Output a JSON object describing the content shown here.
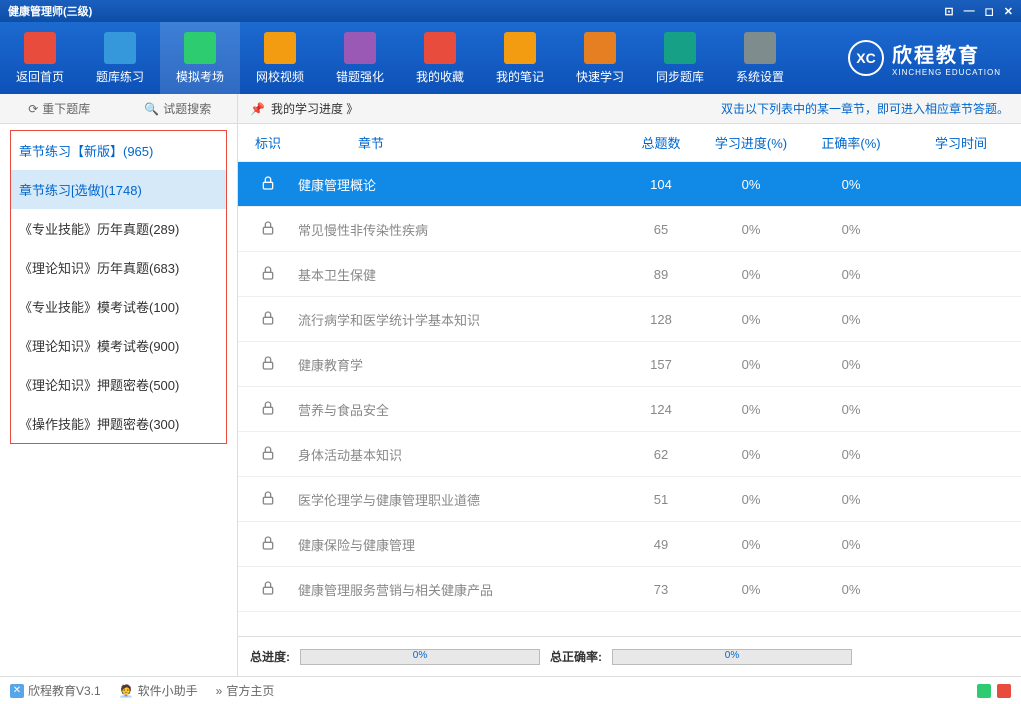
{
  "window": {
    "title": "健康管理师(三级)"
  },
  "toolbar": {
    "items": [
      {
        "label": "返回首页"
      },
      {
        "label": "题库练习"
      },
      {
        "label": "模拟考场"
      },
      {
        "label": "网校视频"
      },
      {
        "label": "错题强化"
      },
      {
        "label": "我的收藏"
      },
      {
        "label": "我的笔记"
      },
      {
        "label": "快速学习"
      },
      {
        "label": "同步题库"
      },
      {
        "label": "系统设置"
      }
    ],
    "active_index": 2
  },
  "brand": {
    "code": "XC",
    "cn": "欣程教育",
    "en": "XINCHENG EDUCATION"
  },
  "subbar": {
    "reload": "重下题库",
    "search": "试题搜索",
    "progress": "我的学习进度 》",
    "hint": "双击以下列表中的某一章节，即可进入相应章节答题。"
  },
  "sidebar": {
    "items": [
      {
        "label": "章节练习【新版】(965)",
        "blue": true
      },
      {
        "label": "章节练习[选做](1748)",
        "selected": true
      },
      {
        "label": "《专业技能》历年真题(289)"
      },
      {
        "label": "《理论知识》历年真题(683)"
      },
      {
        "label": "《专业技能》模考试卷(100)"
      },
      {
        "label": "《理论知识》模考试卷(900)"
      },
      {
        "label": "《理论知识》押题密卷(500)"
      },
      {
        "label": "《操作技能》押题密卷(300)"
      }
    ]
  },
  "table": {
    "headers": {
      "flag": "标识",
      "chapter": "章节",
      "total": "总题数",
      "progress": "学习进度(%)",
      "correct": "正确率(%)",
      "time": "学习时间"
    },
    "rows": [
      {
        "chapter": "健康管理概论",
        "total": 104,
        "progress": "0%",
        "correct": "0%",
        "active": true
      },
      {
        "chapter": "常见慢性非传染性疾病",
        "total": 65,
        "progress": "0%",
        "correct": "0%"
      },
      {
        "chapter": "基本卫生保健",
        "total": 89,
        "progress": "0%",
        "correct": "0%"
      },
      {
        "chapter": "流行病学和医学统计学基本知识",
        "total": 128,
        "progress": "0%",
        "correct": "0%"
      },
      {
        "chapter": "健康教育学",
        "total": 157,
        "progress": "0%",
        "correct": "0%"
      },
      {
        "chapter": "营养与食品安全",
        "total": 124,
        "progress": "0%",
        "correct": "0%"
      },
      {
        "chapter": "身体活动基本知识",
        "total": 62,
        "progress": "0%",
        "correct": "0%"
      },
      {
        "chapter": "医学伦理学与健康管理职业道德",
        "total": 51,
        "progress": "0%",
        "correct": "0%"
      },
      {
        "chapter": "健康保险与健康管理",
        "total": 49,
        "progress": "0%",
        "correct": "0%"
      },
      {
        "chapter": "健康管理服务营销与相关健康产品",
        "total": 73,
        "progress": "0%",
        "correct": "0%"
      }
    ]
  },
  "summary": {
    "total_progress_label": "总进度:",
    "total_progress_value": "0%",
    "total_correct_label": "总正确率:",
    "total_correct_value": "0%"
  },
  "status": {
    "app": "欣程教育V3.1",
    "helper": "软件小助手",
    "home": "官方主页"
  },
  "icons": {
    "colors": [
      "#e74c3c",
      "#3498db",
      "#2ecc71",
      "#f39c12",
      "#9b59b6",
      "#e74c3c",
      "#f39c12",
      "#e67e22",
      "#16a085",
      "#7f8c8d"
    ]
  }
}
